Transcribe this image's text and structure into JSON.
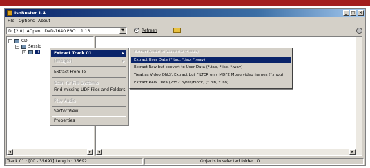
{
  "colors": {
    "band": "#a31e1e",
    "title_bar": "#0a246a",
    "highlight": "#0a246a",
    "face": "#d4d0c8"
  },
  "window": {
    "title": "IsoBuster 1.4",
    "title_icon": "isobuster-app-icon",
    "buttons": [
      "_",
      "□",
      "×"
    ]
  },
  "menubar": {
    "items": [
      "File",
      "Options",
      "About"
    ]
  },
  "toolbar": {
    "drive_value": "D: [2,0]  AOpen   DVD-1640 PRO    1.13",
    "refresh_label": "Refresh",
    "dropdown_icon": "chevron-down-icon"
  },
  "tree": {
    "cd_label": "CD",
    "session_label": "Sessio",
    "track_label": "Tr"
  },
  "context_menu": {
    "items": [
      {
        "label": "Extract Track 01",
        "state": "highlighted",
        "submenu": true
      },
      {
        "label": "[Images]",
        "state": "disabled",
        "submenu": true
      },
      {
        "label": "Extract From-To",
        "state": "normal"
      },
      {
        "label": "Scan for File Systems",
        "state": "disabled"
      },
      {
        "label": "Find missing UDF Files and Folders",
        "state": "normal"
      },
      {
        "label": "Play Audio",
        "state": "disabled"
      },
      {
        "label": "Sector View",
        "state": "normal"
      },
      {
        "label": "Properties",
        "state": "normal"
      }
    ]
  },
  "submenu": {
    "items": [
      {
        "label": "Extract Audio to Wave file (*.wav)",
        "state": "disabled"
      },
      {
        "label": "Extract User Data (*.tao, *.iso, *.wav)",
        "state": "highlighted"
      },
      {
        "label": "Extract Raw but convert to User Data (*.tao, *.iso, *.wav)",
        "state": "normal"
      },
      {
        "label": "Treat as Video ONLY, Extract but FILTER only MDF2 Mpeg video frames (*.mpg)",
        "state": "normal"
      },
      {
        "label": "Extract RAW Data (2352 bytes/block) (*.bin, *.iso)",
        "state": "normal"
      }
    ]
  },
  "statusbar": {
    "left": "Track 01 : [00 - 35691]  Length : 35692",
    "right": "Objects in selected folder : 0"
  }
}
